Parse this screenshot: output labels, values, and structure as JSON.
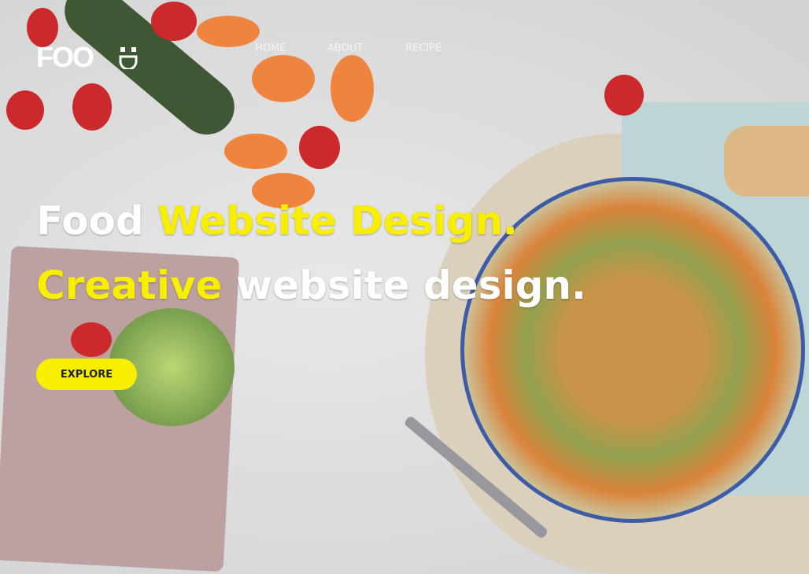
{
  "logo": {
    "text": "FOO"
  },
  "nav": [
    {
      "label": "HOME"
    },
    {
      "label": "ABOUT"
    },
    {
      "label": "RECIPE"
    }
  ],
  "hero": {
    "line1_white": "Food ",
    "line1_yellow": "Website Design.",
    "line2_yellow": "Creative ",
    "line2_white": "website design.",
    "button": "EXPLORE"
  },
  "colors": {
    "accent": "#f7ee00"
  }
}
